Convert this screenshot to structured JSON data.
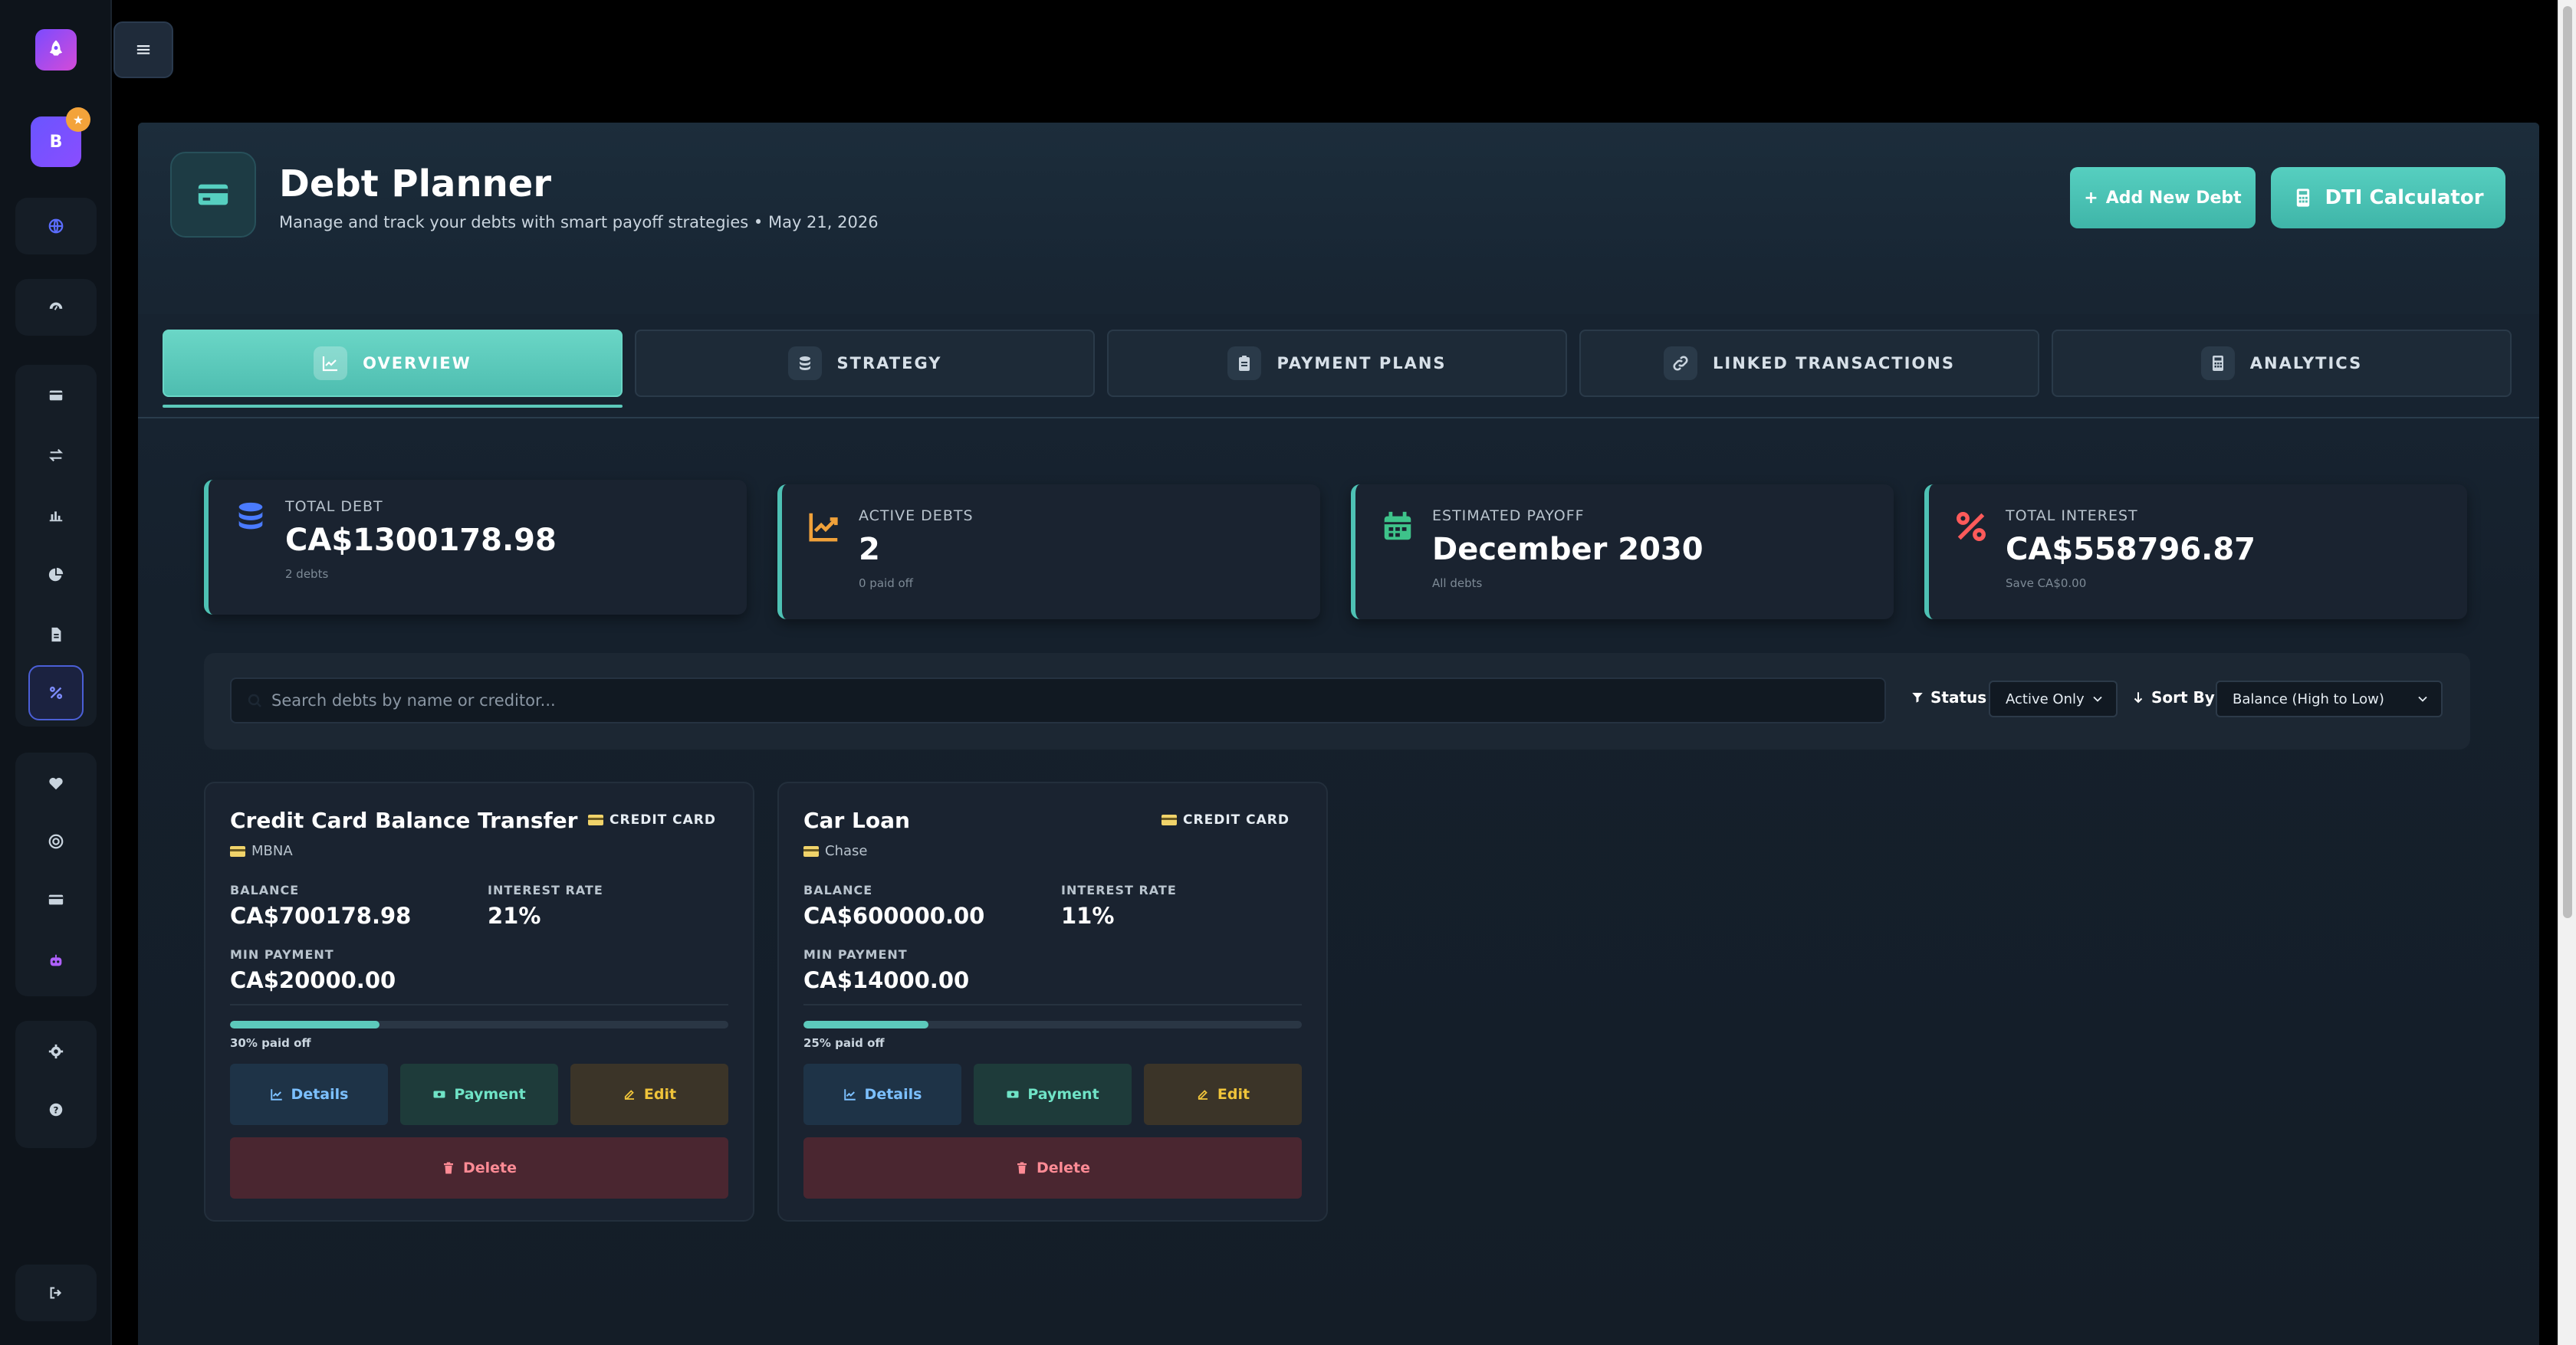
{
  "colors": {
    "accent": "#56cfc0",
    "danger": "#ff8b95",
    "warning": "#f0c43a",
    "info": "#7cc0ff",
    "background": "#141d27"
  },
  "sidebar": {
    "avatar_initial": "B",
    "avatar_badge": "★",
    "icons": [
      "globe-icon",
      "dashboard-icon",
      "wallet-icon",
      "transfer-icon",
      "bar-chart-icon",
      "pie-chart-icon",
      "document-icon",
      "percent-icon",
      "heart-icon",
      "target-icon",
      "card-icon",
      "robot-icon",
      "gear-icon",
      "help-icon",
      "logout-icon"
    ]
  },
  "menu": {
    "glyph": "≡"
  },
  "header": {
    "title": "Debt Planner",
    "subtitle": "Manage and track your debts with smart payoff strategies • May 21, 2026",
    "add_label": "Add New Debt",
    "add_prefix": "+",
    "dti_label": "DTI Calculator"
  },
  "tabs": [
    {
      "label": "OVERVIEW",
      "active": true
    },
    {
      "label": "STRATEGY",
      "active": false
    },
    {
      "label": "PAYMENT PLANS",
      "active": false
    },
    {
      "label": "LINKED TRANSACTIONS",
      "active": false
    },
    {
      "label": "ANALYTICS",
      "active": false
    }
  ],
  "stats": [
    {
      "label": "TOTAL DEBT",
      "value": "CA$1300178.98",
      "sub": "2 debts",
      "icon": "coins-icon"
    },
    {
      "label": "ACTIVE DEBTS",
      "value": "2",
      "sub": "0 paid off",
      "icon": "trend-icon"
    },
    {
      "label": "ESTIMATED PAYOFF",
      "value": "December 2030",
      "sub": "All debts",
      "icon": "calendar-icon"
    },
    {
      "label": "TOTAL INTEREST",
      "value": "CA$558796.87",
      "sub": "Save CA$0.00",
      "icon": "percent-icon"
    }
  ],
  "filters": {
    "search_placeholder": "Search debts by name or creditor...",
    "status_label": "Status",
    "status_value": "Active Only",
    "sort_label": "Sort By",
    "sort_value": "Balance (High to Low)"
  },
  "debt_labels": {
    "balance": "BALANCE",
    "interest": "INTEREST RATE",
    "min_payment": "MIN PAYMENT",
    "details": "Details",
    "payment": "Payment",
    "edit": "Edit",
    "delete": "Delete"
  },
  "debts": [
    {
      "name": "Credit Card Balance Transfer",
      "type": "CREDIT CARD",
      "creditor": "MBNA",
      "balance": "CA$700178.98",
      "interest": "21%",
      "min_payment": "CA$20000.00",
      "progress": 0.3,
      "progress_label": "30% paid off"
    },
    {
      "name": "Car Loan",
      "type": "CREDIT CARD",
      "creditor": "Chase",
      "balance": "CA$600000.00",
      "interest": "11%",
      "min_payment": "CA$14000.00",
      "progress": 0.25,
      "progress_label": "25% paid off"
    }
  ]
}
